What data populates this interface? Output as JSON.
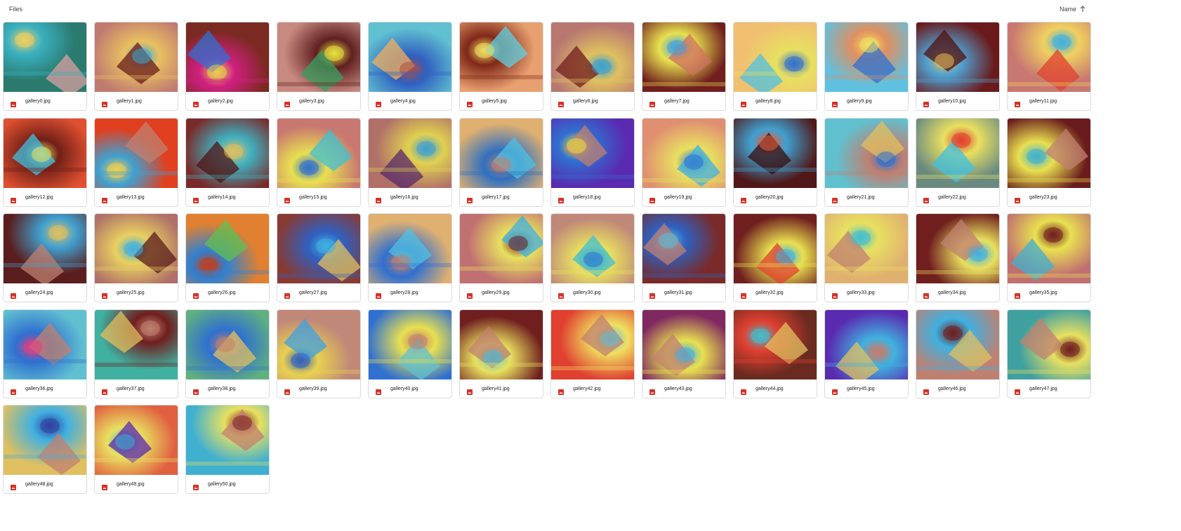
{
  "header": {
    "title": "Files",
    "sort_label": "Name",
    "sort_direction_icon": "arrow-up-icon"
  },
  "accent_colors": {
    "image_file_icon": "#d93025",
    "card_border": "#dadce0"
  },
  "file_icon_name": "image-file-icon",
  "files": [
    {
      "name": "gallery0.jpg",
      "colors": [
        "#2a7a6e",
        "#d8a0a0",
        "#f0d060",
        "#3ab0c0"
      ]
    },
    {
      "name": "gallery1.jpg",
      "colors": [
        "#c07a70",
        "#6a1c1c",
        "#40a8d0",
        "#e8c060"
      ]
    },
    {
      "name": "gallery2.jpg",
      "colors": [
        "#7a2a20",
        "#3070d0",
        "#e8d050",
        "#d02080"
      ]
    },
    {
      "name": "gallery3.jpg",
      "colors": [
        "#c88a80",
        "#3aa060",
        "#e8e040",
        "#602020"
      ]
    },
    {
      "name": "gallery4.jpg",
      "colors": [
        "#60c0d0",
        "#f0b060",
        "#a05050",
        "#3060c0"
      ]
    },
    {
      "name": "gallery5.jpg",
      "colors": [
        "#e8a070",
        "#60d0e0",
        "#f0e060",
        "#802818"
      ]
    },
    {
      "name": "gallery6.jpg",
      "colors": [
        "#b87870",
        "#701e1e",
        "#3aa0d0",
        "#e0c060"
      ]
    },
    {
      "name": "gallery7.jpg",
      "colors": [
        "#701e1e",
        "#d07060",
        "#40a0e0",
        "#e8e050"
      ]
    },
    {
      "name": "gallery8.jpg",
      "colors": [
        "#f0c070",
        "#50c0e0",
        "#3070d0",
        "#e8e060"
      ]
    },
    {
      "name": "gallery9.jpg",
      "colors": [
        "#60c0e0",
        "#3070d0",
        "#f0e060",
        "#e09060"
      ]
    },
    {
      "name": "gallery10.jpg",
      "colors": [
        "#6a1a1a",
        "#501010",
        "#e0c060",
        "#50a0d0"
      ]
    },
    {
      "name": "gallery11.jpg",
      "colors": [
        "#c87870",
        "#e04030",
        "#40b0e0",
        "#f0d060"
      ]
    },
    {
      "name": "gallery12.jpg",
      "colors": [
        "#e05030",
        "#40c0e0",
        "#e8e060",
        "#702018"
      ]
    },
    {
      "name": "gallery13.jpg",
      "colors": [
        "#e04020",
        "#c08070",
        "#f0d050",
        "#40a0d0"
      ]
    },
    {
      "name": "gallery14.jpg",
      "colors": [
        "#7a2a28",
        "#501414",
        "#e0c060",
        "#40b0c0"
      ]
    },
    {
      "name": "gallery15.jpg",
      "colors": [
        "#c87870",
        "#40c0d0",
        "#3070d0",
        "#e8e050"
      ]
    },
    {
      "name": "gallery16.jpg",
      "colors": [
        "#b07068",
        "#5a2a6a",
        "#40a0d0",
        "#e0d050"
      ]
    },
    {
      "name": "gallery17.jpg",
      "colors": [
        "#e0b070",
        "#50c0e0",
        "#c08070",
        "#3070c0"
      ]
    },
    {
      "name": "gallery18.jpg",
      "colors": [
        "#5a2ab0",
        "#c08070",
        "#e8e040",
        "#3070d0"
      ]
    },
    {
      "name": "gallery19.jpg",
      "colors": [
        "#e09070",
        "#40b0e0",
        "#3070d0",
        "#e8e060"
      ]
    },
    {
      "name": "gallery20.jpg",
      "colors": [
        "#501818",
        "#3a0e0e",
        "#e06040",
        "#40a0d0"
      ]
    },
    {
      "name": "gallery21.jpg",
      "colors": [
        "#60c0d0",
        "#e0c060",
        "#3070d0",
        "#c08070"
      ]
    },
    {
      "name": "gallery22.jpg",
      "colors": [
        "#6a8a80",
        "#40c0e0",
        "#e04030",
        "#e8e060"
      ]
    },
    {
      "name": "gallery23.jpg",
      "colors": [
        "#6a1c1c",
        "#c08070",
        "#40b0d0",
        "#e8e050"
      ]
    },
    {
      "name": "gallery24.jpg",
      "colors": [
        "#5a1e1e",
        "#c08070",
        "#e0c060",
        "#40a0d0"
      ]
    },
    {
      "name": "gallery25.jpg",
      "colors": [
        "#b07068",
        "#5a1c1c",
        "#40b0e0",
        "#e8d060"
      ]
    },
    {
      "name": "gallery26.jpg",
      "colors": [
        "#e08030",
        "#60c050",
        "#c04020",
        "#3080d0"
      ]
    },
    {
      "name": "gallery27.jpg",
      "colors": [
        "#8a3a30",
        "#e0c060",
        "#40b0e0",
        "#3060c0"
      ]
    },
    {
      "name": "gallery28.jpg",
      "colors": [
        "#e0b070",
        "#50c0e0",
        "#c08070",
        "#3070d0"
      ]
    },
    {
      "name": "gallery29.jpg",
      "colors": [
        "#c07070",
        "#40b0e0",
        "#701e1e",
        "#e8e060"
      ]
    },
    {
      "name": "gallery30.jpg",
      "colors": [
        "#c08878",
        "#40c0d0",
        "#3070d0",
        "#e8e060"
      ]
    },
    {
      "name": "gallery31.jpg",
      "colors": [
        "#7a2a28",
        "#c08070",
        "#50c0e0",
        "#3060c0"
      ]
    },
    {
      "name": "gallery32.jpg",
      "colors": [
        "#701e1e",
        "#e04030",
        "#40b0e0",
        "#e8e050"
      ]
    },
    {
      "name": "gallery33.jpg",
      "colors": [
        "#e0b070",
        "#c08070",
        "#40c0d0",
        "#e8e060"
      ]
    },
    {
      "name": "gallery34.jpg",
      "colors": [
        "#701e1e",
        "#c08070",
        "#40b0e0",
        "#e8e060"
      ]
    },
    {
      "name": "gallery35.jpg",
      "colors": [
        "#c07070",
        "#40b0d0",
        "#701e1e",
        "#e8e050"
      ]
    },
    {
      "name": "gallery36.jpg",
      "colors": [
        "#60c0d0",
        "#c08070",
        "#e04080",
        "#3070d0"
      ]
    },
    {
      "name": "gallery37.jpg",
      "colors": [
        "#40b0a0",
        "#e0c060",
        "#c08070",
        "#701e1e"
      ]
    },
    {
      "name": "gallery38.jpg",
      "colors": [
        "#60b080",
        "#e0c060",
        "#c08070",
        "#3070d0"
      ]
    },
    {
      "name": "gallery39.jpg",
      "colors": [
        "#c08878",
        "#40a0e0",
        "#3060c0",
        "#e8d050"
      ]
    },
    {
      "name": "gallery40.jpg",
      "colors": [
        "#3070d0",
        "#60c0d0",
        "#c08070",
        "#e8e050"
      ]
    },
    {
      "name": "gallery41.jpg",
      "colors": [
        "#701e1e",
        "#c08070",
        "#40c0e0",
        "#e8e060"
      ]
    },
    {
      "name": "gallery42.jpg",
      "colors": [
        "#e04030",
        "#c08070",
        "#60c0d0",
        "#f0e060"
      ]
    },
    {
      "name": "gallery43.jpg",
      "colors": [
        "#802860",
        "#c08070",
        "#40b0e0",
        "#e8e050"
      ]
    },
    {
      "name": "gallery44.jpg",
      "colors": [
        "#6a2a20",
        "#e0c060",
        "#40c0d0",
        "#e04030"
      ]
    },
    {
      "name": "gallery45.jpg",
      "colors": [
        "#5a2ab0",
        "#e0c060",
        "#c08070",
        "#40b0e0"
      ]
    },
    {
      "name": "gallery46.jpg",
      "colors": [
        "#c08070",
        "#e0c060",
        "#701e1e",
        "#40b0e0"
      ]
    },
    {
      "name": "gallery47.jpg",
      "colors": [
        "#40a0a0",
        "#c08070",
        "#701e1e",
        "#e8e060"
      ]
    },
    {
      "name": "gallery48.jpg",
      "colors": [
        "#e0c060",
        "#c08070",
        "#3040a0",
        "#40b0e0"
      ]
    },
    {
      "name": "gallery49.jpg",
      "colors": [
        "#e06040",
        "#5a2ab0",
        "#40b0d0",
        "#e8e060"
      ]
    },
    {
      "name": "gallery50.jpg",
      "colors": [
        "#40b0d0",
        "#c08070",
        "#802020",
        "#e8e060"
      ]
    }
  ]
}
